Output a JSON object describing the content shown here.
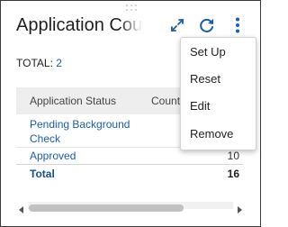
{
  "widget": {
    "title": "Application Count",
    "total_label": "TOTAL:",
    "total_value": "2"
  },
  "icons": {
    "expand": "expand-icon",
    "refresh": "refresh-icon",
    "more": "more-vertical-icon",
    "drag": "drag-handle-icon"
  },
  "table": {
    "headers": [
      "Application Status",
      "Count"
    ],
    "rows": [
      {
        "status": "Pending Background Check",
        "count": ""
      },
      {
        "status": "Approved",
        "count": "10"
      }
    ],
    "total": {
      "label": "Total",
      "count": "16"
    }
  },
  "menu": {
    "items": [
      "Set Up",
      "Reset",
      "Edit",
      "Remove"
    ]
  },
  "colors": {
    "accent": "#1a5ea8",
    "header_bg": "#eeeeee"
  }
}
